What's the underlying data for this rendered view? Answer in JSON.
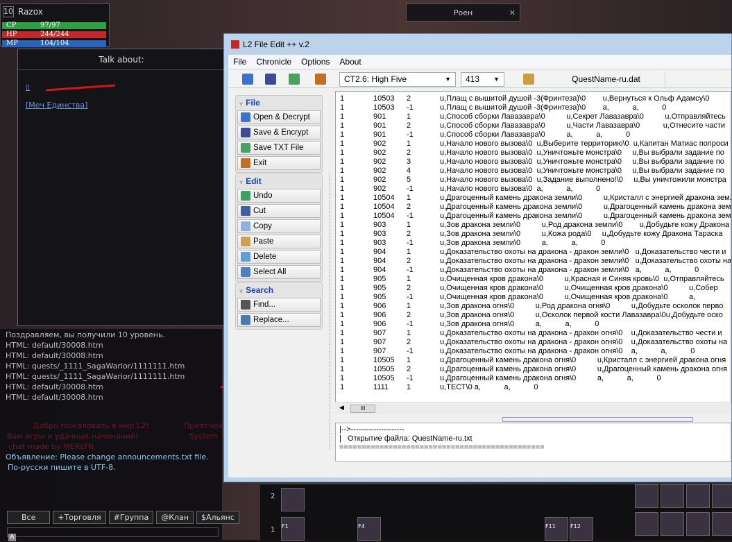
{
  "game": {
    "player": {
      "level": "10",
      "name": "Razox",
      "cp": {
        "label": "CP",
        "value": "97/97",
        "fraction": 1.0,
        "color": "#2ea043"
      },
      "hp": {
        "label": "HP",
        "value": "244/244",
        "fraction": 1.0,
        "color": "#c0282a"
      },
      "mp": {
        "label": "MP",
        "value": "104/104",
        "fraction": 1.0,
        "color": "#2a64b8"
      }
    },
    "target_window": {
      "title": "Роен",
      "close": "✕"
    },
    "talk": {
      "title": "Talk about:",
      "link1": "▯",
      "link2": "[Меч Единства]"
    },
    "chat": {
      "system_lines": [
        "Поздравляем, вы получили 10 уровень.",
        "HTML: default/30008.htm",
        "HTML: default/30008.htm",
        "HTML: quests/_1111_SagaWarior/1111111.htm",
        "HTML: quests/_1111_SagaWarior/1111111.htm",
        "HTML: default/30008.htm",
        "HTML: default/30008.htm"
      ],
      "welcome_lines": [
        "Добро пожаловать в мир L2!",
        "Вам игры и удачных начинаний!",
        "chat made by MERLYN.",
        "Приятной",
        "System"
      ],
      "announce_lines": [
        "Объявление: Please change announcements.txt file.",
        "По-русски пишите в UTF-8."
      ],
      "tabs": [
        "Все",
        "+Торговля",
        "#Группа",
        "@Клан",
        "$Альянс"
      ],
      "input_icon": "A"
    },
    "hotbar": {
      "page_labels": [
        "2",
        "1"
      ],
      "keys": [
        "F1",
        "F4",
        "F11",
        "F12"
      ]
    }
  },
  "editor": {
    "title": "L2 File Edit ++ v.2",
    "menu": [
      "File",
      "Chronicle",
      "Options",
      "About"
    ],
    "toolbar": {
      "chronicle": "CT2.6: High Five",
      "version": "413",
      "file": "QuestName-ru.dat"
    },
    "sidebar": [
      {
        "header": "File",
        "items": [
          "Open & Decrypt",
          "Save & Encrypt",
          "Save TXT File",
          "Exit"
        ]
      },
      {
        "header": "Edit",
        "items": [
          "Undo",
          "Cut",
          "Copy",
          "Paste",
          "Delete",
          "Select All"
        ]
      },
      {
        "header": "Search",
        "items": [
          "Find...",
          "Replace..."
        ]
      }
    ],
    "rows": [
      [
        "1",
        "10503",
        "2",
        "u,Плащ с вышитой душой -3(Фринтеза)\\0        u,Вернуться к Ольф Адамсу\\0"
      ],
      [
        "1",
        "10503",
        "-1",
        "u,Плащ с вышитой душой -3(Фринтеза)\\0        a,           a,           0"
      ],
      [
        "1",
        "901",
        "1",
        "u,Способ сборки Лавазавра\\0          u,Секрет Лавазавра\\0          u,Отправляйтесь"
      ],
      [
        "1",
        "901",
        "2",
        "u,Способ сборки Лавазавра\\0          u,Части Лавазавра\\0           u,Отнесите части"
      ],
      [
        "1",
        "901",
        "-1",
        "u,Способ сборки Лавазавра\\0          a,           a,           0"
      ],
      [
        "1",
        "902",
        "1",
        "u,Начало нового вызова\\0  u,Выберите территорию\\0  u,Капитан Матиас попроси"
      ],
      [
        "1",
        "902",
        "2",
        "u,Начало нового вызова\\0  u,Уничтожьте монстра\\0     u,Вы выбрали задание по"
      ],
      [
        "1",
        "902",
        "3",
        "u,Начало нового вызова\\0  u,Уничтожьте монстра\\0     u,Вы выбрали задание по"
      ],
      [
        "1",
        "902",
        "4",
        "u,Начало нового вызова\\0  u,Уничтожьте монстра\\0     u,Вы выбрали задание по"
      ],
      [
        "1",
        "902",
        "5",
        "u,Начало нового вызова\\0  u,Задание выполнено!\\0     u,Вы уничтожили монстра"
      ],
      [
        "1",
        "902",
        "-1",
        "u,Начало нового вызова\\0  a,           a,           0"
      ],
      [
        "1",
        "10504",
        "1",
        "u,Драгоценный камень дракона земли\\0          u,Кристалл с энергией дракона земли"
      ],
      [
        "1",
        "10504",
        "2",
        "u,Драгоценный камень дракона земли\\0          u,Драгоценный камень дракона земли"
      ],
      [
        "1",
        "10504",
        "-1",
        "u,Драгоценный камень дракона земли\\0          u,Драгоценный камень дракона земли"
      ],
      [
        "1",
        "903",
        "1",
        "u,Зов дракона земли\\0          u,Род дракона земли\\0        u,Добудьте кожу Дракона"
      ],
      [
        "1",
        "903",
        "2",
        "u,Зов дракона земли\\0          u,Кожа рода\\0     u,Добудьте кожу Дракона Тараска"
      ],
      [
        "1",
        "903",
        "-1",
        "u,Зов дракона земли\\0          a,           a,           0"
      ],
      [
        "1",
        "904",
        "1",
        "u,Доказательство охоты на дракона - дракон земли\\0   u,Доказательство чести и"
      ],
      [
        "1",
        "904",
        "2",
        "u,Доказательство охоты на дракона - дракон земли\\0   u,Доказательство охоты на"
      ],
      [
        "1",
        "904",
        "-1",
        "u,Доказательство охоты на дракона - дракон земли\\0   a,           a,           0"
      ],
      [
        "1",
        "905",
        "1",
        "u,Очищенная кров дракона\\0          u,Красная и Синяя кровь\\0  u,Отправляйтесь"
      ],
      [
        "1",
        "905",
        "2",
        "u,Очищенная кров дракона\\0          u,Очищенная кров дракона\\0          u,Собер"
      ],
      [
        "1",
        "905",
        "-1",
        "u,Очищенная кров дракона\\0          u,Очищенная кров дракона\\0          a,"
      ],
      [
        "1",
        "906",
        "1",
        "u,Зов дракона огня\\0          u,Род дракона огня\\0          u,Добудьте осколок перво"
      ],
      [
        "1",
        "906",
        "2",
        "u,Зов дракона огня\\0          u,Осколок первой кости Лавазавра\\0u,Добудьте оско"
      ],
      [
        "1",
        "906",
        "-1",
        "u,Зов дракона огня\\0          a,           a,           0"
      ],
      [
        "1",
        "907",
        "1",
        "u,Доказательство охоты на дракона - дракон огня\\0    u,Доказательство чести и"
      ],
      [
        "1",
        "907",
        "2",
        "u,Доказательство охоты на дракона - дракон огня\\0    u,Доказательство охоты на"
      ],
      [
        "1",
        "907",
        "-1",
        "u,Доказательство охоты на дракона - дракон огня\\0    a,           a,           0"
      ],
      [
        "1",
        "10505",
        "1",
        "u,Драгоценный камень дракона огня\\0          u,Кристалл с энергией дракона огня"
      ],
      [
        "1",
        "10505",
        "2",
        "u,Драгоценный камень дракона огня\\0          u,Драгоценный камень дракона огня"
      ],
      [
        "1",
        "10505",
        "-1",
        "u,Драгоценный камень дракона огня\\0          a,           a,           0"
      ],
      [
        "1",
        "1111",
        "1",
        "u,ТЕСТ\\0 a,           a,           0"
      ]
    ],
    "scroll_thumb": "III",
    "log": "|-->---------------------\n|   Открытие файла: QuestName-ru.txt\n=============================================="
  }
}
